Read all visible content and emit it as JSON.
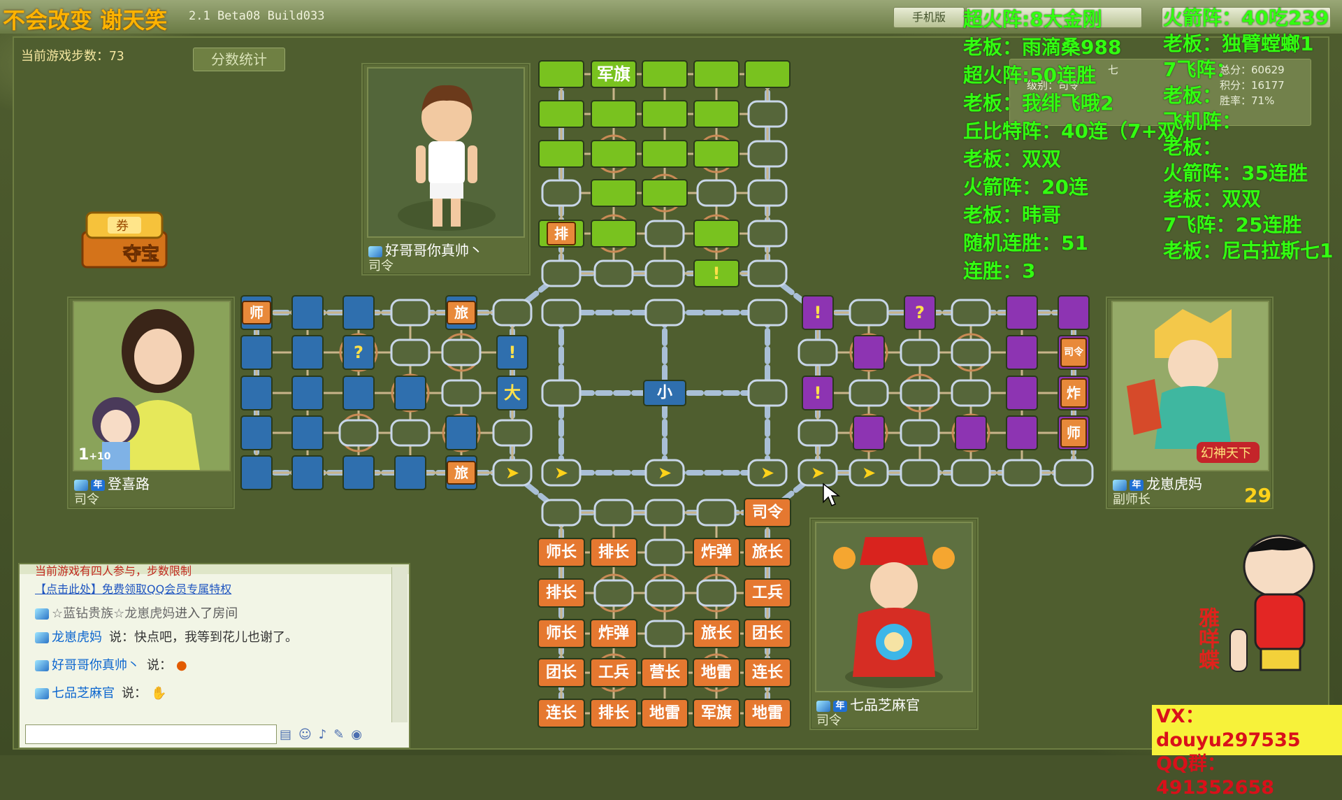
{
  "window": {
    "title_overlay": "不会改变    谢天笑",
    "version": "2.1 Beta08 Build033",
    "mobile_btn": "手机版"
  },
  "game": {
    "steps_label": "当前游戏步数：73",
    "score_btn": "分数统计",
    "treasure_label": "夺宝",
    "treasure_ticket": "券"
  },
  "players": {
    "top": {
      "name": "好哥哥你真帅丶",
      "rank": "司令"
    },
    "left": {
      "name": "登喜路",
      "rank": "司令",
      "level": "1",
      "level_bonus": "+10"
    },
    "right": {
      "name": "龙崽虎妈",
      "rank": "副师长",
      "timer": "29"
    },
    "bottom": {
      "name": "七品芝麻官",
      "rank": "司令"
    }
  },
  "board": {
    "top_pieces": [
      {
        "cell": [
          0,
          1
        ],
        "label": "军旗"
      },
      {
        "cell": [
          4,
          0
        ],
        "label": "排"
      },
      {
        "cell": [
          5,
          3
        ],
        "label": "!"
      }
    ],
    "left_pieces": [
      {
        "cell": [
          0,
          0
        ],
        "label": "师"
      },
      {
        "cell": [
          0,
          4
        ],
        "label": "旅"
      },
      {
        "cell": [
          1,
          2
        ],
        "label": "?"
      },
      {
        "cell": [
          1,
          5
        ],
        "label": "!"
      },
      {
        "cell": [
          2,
          5
        ],
        "label": "大"
      },
      {
        "cell": [
          4,
          4
        ],
        "label": "旅"
      }
    ],
    "right_pieces": [
      {
        "cell": [
          0,
          0
        ],
        "label": "!"
      },
      {
        "cell": [
          0,
          2
        ],
        "label": "?"
      },
      {
        "cell": [
          2,
          0
        ],
        "label": "!"
      },
      {
        "cell": [
          1,
          5
        ],
        "label": "司令"
      },
      {
        "cell": [
          2,
          5
        ],
        "label": "炸"
      },
      {
        "cell": [
          3,
          5
        ],
        "label": "师"
      }
    ],
    "center_piece": "小",
    "bottom_pieces": [
      [
        "",
        "",
        "",
        "",
        "司令"
      ],
      [
        "师长",
        "排长",
        "",
        "炸弹",
        "旅长"
      ],
      [
        "排长",
        "",
        "",
        "",
        "工兵"
      ],
      [
        "师长",
        "炸弹",
        "",
        "旅长",
        "团长"
      ],
      [
        "团长",
        "工兵",
        "营长",
        "地雷",
        "连长"
      ],
      [
        "连长",
        "排长",
        "地雷",
        "军旗",
        "地雷"
      ]
    ],
    "arrow_glyph": "➤"
  },
  "chat": {
    "header": "当前游戏有四人参与，步数限制",
    "link": "【点击此处】免费领取QQ会员专属特权",
    "messages": [
      {
        "who": "☆蓝钻贵族☆龙崽虎妈",
        "text": "进入了房间"
      },
      {
        "who": "龙崽虎妈",
        "text": "说：快点吧，我等到花儿也谢了。"
      },
      {
        "who": "好哥哥你真帅丶",
        "text": "说："
      },
      {
        "who": "七品芝麻官",
        "text": "说："
      }
    ]
  },
  "side_info": {
    "name_prefix": "七",
    "level": "级别：司令",
    "score_total": "总分：60629",
    "points": "积分：16177",
    "win_rate": "胜率：71%"
  },
  "overlay_left": [
    "超火阵:8大金刚",
    "老板：雨滴桑988",
    "超火阵:50连胜",
    "老板：我绯飞哦2",
    "丘比特阵：40连（7+双）",
    "老板：双双",
    "火箭阵：20连",
    "老板：𬀩哥",
    "随机连胜：51",
    "连胜：3"
  ],
  "overlay_right": [
    "火箭阵：40吃239",
    "老板：独臂螳螂1",
    "7飞阵：",
    "老板：",
    "飞机阵：",
    "老板：",
    "火箭阵：35连胜",
    "老板：双双",
    "7飞阵：25连胜",
    "老板：尼古拉斯七1"
  ],
  "sticker": "雅咩蝶",
  "contact": {
    "vx": "VX：douyu297535",
    "qq": "QQ群：491352658"
  },
  "colors": {
    "green": "#79c21f",
    "blue": "#2f6fae",
    "purple": "#8d34b2",
    "orange": "#e57830",
    "rail": "#a9bfd6"
  }
}
